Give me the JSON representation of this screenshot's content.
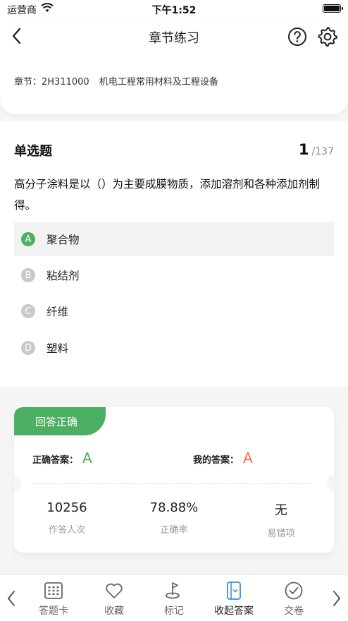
{
  "status_bar": {
    "carrier": "运营商",
    "time": "下午1:52"
  },
  "header": {
    "title": "章节练习",
    "chapter_label": "章节：2H311000",
    "chapter_name": "机电工程常用材料及工程设备"
  },
  "question": {
    "type": "单选题",
    "current": "1",
    "total": "/137",
    "stem": "高分子涂料是以（）为主要成膜物质，添加溶剂和各种添加剂制得。",
    "options": [
      {
        "letter": "A",
        "text": "聚合物",
        "selected": true
      },
      {
        "letter": "B",
        "text": "粘结剂",
        "selected": false
      },
      {
        "letter": "C",
        "text": "纤维",
        "selected": false
      },
      {
        "letter": "D",
        "text": "塑料",
        "selected": false
      }
    ]
  },
  "result": {
    "banner": "回答正确",
    "correct_label": "正确答案：",
    "correct_value": "A",
    "my_label": "我的答案：",
    "my_value": "A",
    "stats": [
      {
        "value": "10256",
        "label": "作答人次"
      },
      {
        "value": "78.88%",
        "label": "正确率"
      },
      {
        "value": "无",
        "label": "易错项"
      }
    ]
  },
  "toolbar": {
    "items": [
      {
        "label": "答题卡",
        "icon": "answer-sheet-icon"
      },
      {
        "label": "收藏",
        "icon": "heart-icon"
      },
      {
        "label": "标记",
        "icon": "flag-icon"
      },
      {
        "label": "收起答案",
        "icon": "collapse-answer-icon"
      },
      {
        "label": "交卷",
        "icon": "submit-check-icon"
      }
    ]
  },
  "colors": {
    "accent_green": "#4caf63",
    "answer_green": "#4caf63",
    "answer_orange": "#f26b3a",
    "inactive_badge": "#c9c9c9"
  }
}
